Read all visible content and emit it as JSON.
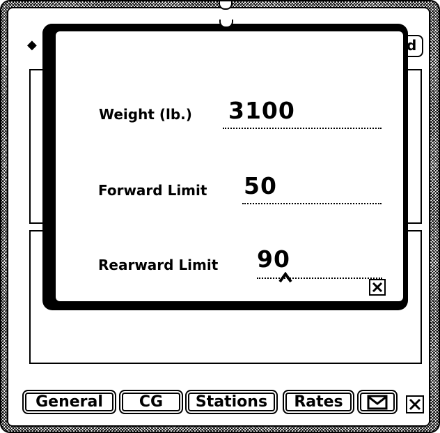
{
  "popup": {
    "fields": [
      {
        "label": "Weight (lb.)",
        "value": "3100"
      },
      {
        "label": "Forward Limit",
        "value": "50"
      },
      {
        "label": "Rearward Limit",
        "value": "90"
      }
    ]
  },
  "background": {
    "top_right_button_label": "d"
  },
  "tabs": [
    {
      "label": "General"
    },
    {
      "label": "CG"
    },
    {
      "label": "Stations"
    },
    {
      "label": "Rates"
    }
  ],
  "icons": {
    "popup_close": "close-box-icon",
    "mail": "envelope-icon",
    "window_close": "close-box-icon",
    "insert_caret": "caret-icon",
    "diamond": "diamond-icon"
  }
}
